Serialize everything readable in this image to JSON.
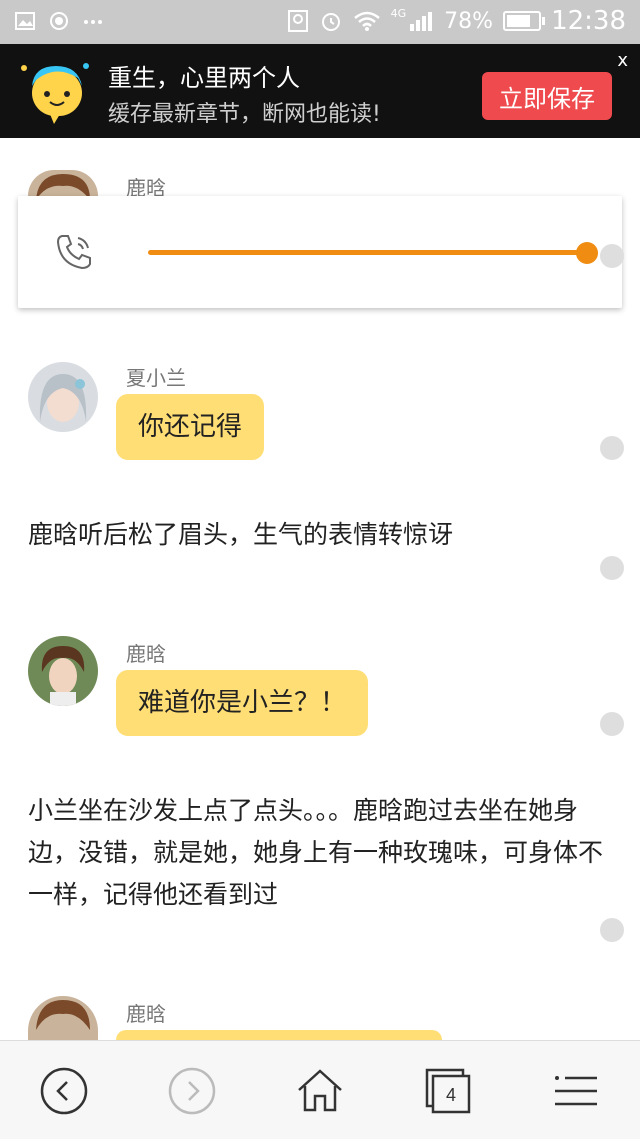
{
  "status_bar": {
    "battery": "78%",
    "time": "12:38",
    "signal_label": "4G",
    "battery_level": 0.78
  },
  "banner": {
    "title": "重生，心里两个人",
    "subtitle": "缓存最新章节，断网也能读!",
    "save_button": "立即保存",
    "close_label": "x"
  },
  "chat": {
    "speaker_1": "鹿晗",
    "audio_progress": 1.0,
    "speaker_2": "夏小兰",
    "bubble_2": "你还记得",
    "narration_1": "鹿晗听后松了眉头，生气的表情转惊讶",
    "speaker_3": "鹿晗",
    "bubble_3": "难道你是小兰？！",
    "narration_2": "小兰坐在沙发上点了点头。。。鹿晗跑过去坐在她身边，没错，就是她，她身上有一种玫瑰味，可身体不一样，记得他还看到过",
    "speaker_4": "鹿晗"
  },
  "toolbar": {
    "tabs_count": "4",
    "icons": [
      "back-icon",
      "forward-icon",
      "home-icon",
      "tabs-icon",
      "menu-icon"
    ]
  },
  "colors": {
    "bubble": "#ffde75",
    "accent": "#ef8c11",
    "save_button": "#ef4a4e"
  }
}
